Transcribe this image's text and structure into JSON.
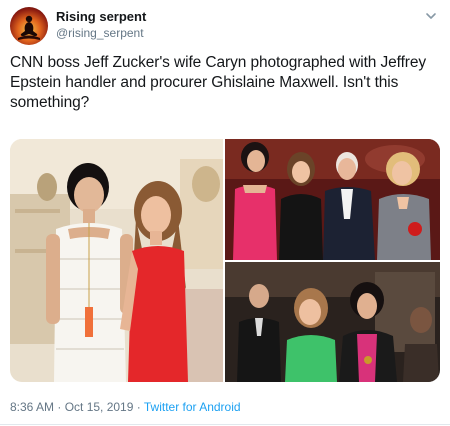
{
  "tweet": {
    "author_name": "Rising serpent",
    "author_handle": "@rising_serpent",
    "text": "CNN boss Jeff Zucker's wife Caryn photographed with Jeffrey Epstein handler and procurer Ghislaine Maxwell. Isn't this something?",
    "timestamp": "8:36 AM · Oct 15, 2019",
    "separator": " · ",
    "source": "Twitter for Android"
  },
  "icons": {
    "avatar": "meditating-figure-flame-avatar",
    "menu": "chevron-down-icon"
  },
  "colors": {
    "text_primary": "#14171a",
    "text_secondary": "#657786",
    "link": "#1da1f2"
  }
}
